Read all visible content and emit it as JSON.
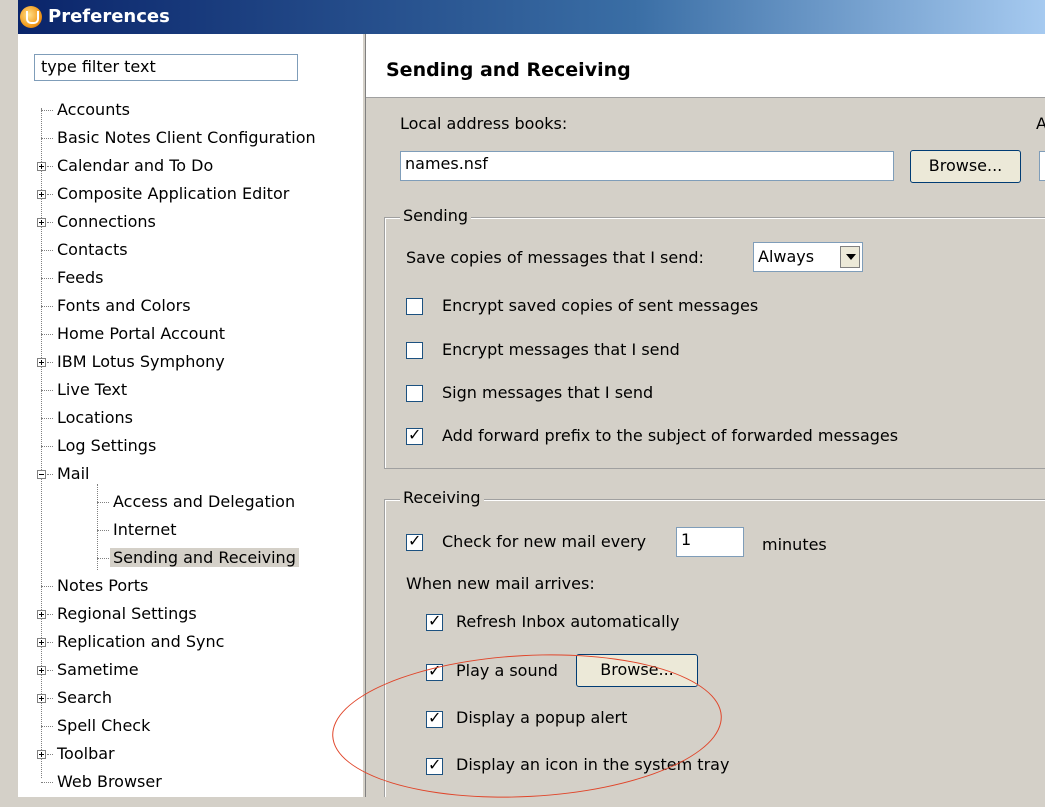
{
  "window": {
    "title": "Preferences"
  },
  "filter": {
    "placeholder": "type filter text"
  },
  "tree": {
    "items": [
      {
        "label": "Accounts"
      },
      {
        "label": "Basic Notes Client Configuration"
      },
      {
        "label": "Calendar and To Do"
      },
      {
        "label": "Composite Application Editor"
      },
      {
        "label": "Connections"
      },
      {
        "label": "Contacts"
      },
      {
        "label": "Feeds"
      },
      {
        "label": "Fonts and Colors"
      },
      {
        "label": "Home Portal Account"
      },
      {
        "label": "IBM Lotus Symphony"
      },
      {
        "label": "Live Text"
      },
      {
        "label": "Locations"
      },
      {
        "label": "Log Settings"
      },
      {
        "label": "Mail"
      },
      {
        "label": "Access and Delegation"
      },
      {
        "label": "Internet"
      },
      {
        "label": "Sending and Receiving"
      },
      {
        "label": "Notes Ports"
      },
      {
        "label": "Regional Settings"
      },
      {
        "label": "Replication and Sync"
      },
      {
        "label": "Sametime"
      },
      {
        "label": "Search"
      },
      {
        "label": "Spell Check"
      },
      {
        "label": "Toolbar"
      },
      {
        "label": "Web Browser"
      }
    ]
  },
  "page": {
    "title": "Sending and Receiving",
    "local_address_books_label": "Local address books:",
    "right_cut_label": "A",
    "address_books_value": "names.nsf",
    "browse_label": "Browse...",
    "sending": {
      "legend": "Sending",
      "save_copies_label": "Save copies of messages that I send:",
      "save_copies_value": "Always",
      "encrypt_saved_label": "Encrypt saved copies of sent messages",
      "encrypt_send_label": "Encrypt messages that I send",
      "sign_label": "Sign messages that I send",
      "forward_prefix_label": "Add forward prefix to the subject of forwarded messages"
    },
    "receiving": {
      "legend": "Receiving",
      "check_mail_label": "Check for new mail every",
      "check_mail_value": "1",
      "minutes_label": "minutes",
      "when_new_mail_label": "When new mail arrives:",
      "refresh_inbox_label": "Refresh Inbox automatically",
      "play_sound_label": "Play a sound",
      "sound_browse_label": "Browse...",
      "popup_alert_label": "Display a popup alert",
      "tray_icon_label": "Display an icon in the system tray"
    }
  },
  "states": {
    "encrypt_saved": false,
    "encrypt_send": false,
    "sign": false,
    "forward_prefix": true,
    "check_mail": true,
    "refresh_inbox": true,
    "play_sound": true,
    "popup_alert": true,
    "tray_icon": true
  },
  "colors": {
    "annotation": "#e0452a",
    "titlebar": "#0a246a"
  }
}
